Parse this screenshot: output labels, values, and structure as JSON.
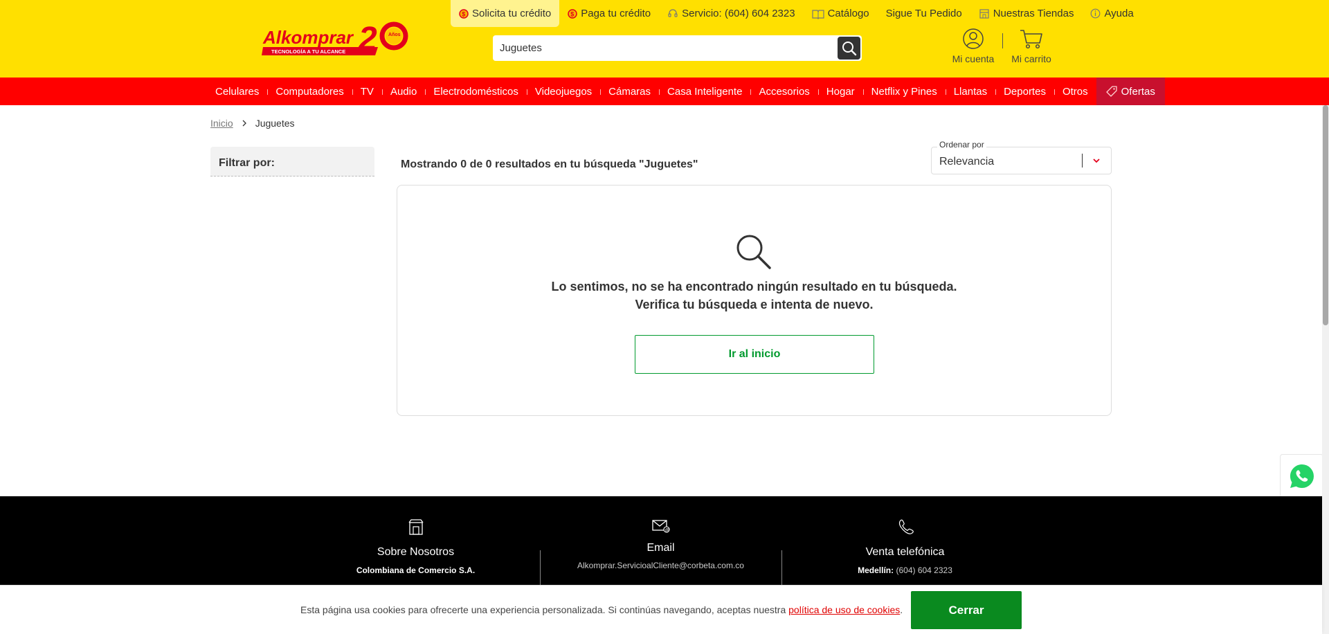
{
  "header": {
    "logo_brand": "Alkomprar",
    "logo_tagline": "TECNOLOGÍA A TU ALCANCE",
    "logo_number": "20",
    "logo_years": "Años",
    "top_links": [
      {
        "label": "Solicita tu crédito",
        "icon": "credit-coin-icon"
      },
      {
        "label": "Paga tu crédito",
        "icon": "credit-coin-icon"
      },
      {
        "label": "Servicio: (604) 604 2323",
        "icon": "headset-icon"
      },
      {
        "label": "Catálogo",
        "icon": "book-icon"
      },
      {
        "label": "Sigue Tu Pedido",
        "icon": ""
      },
      {
        "label": "Nuestras Tiendas",
        "icon": "store-icon"
      },
      {
        "label": "Ayuda",
        "icon": "info-icon"
      }
    ],
    "search": {
      "value": "Juguetes",
      "icon": "search-icon"
    },
    "account_label": "Mi cuenta",
    "cart_label": "Mi carrito"
  },
  "nav": {
    "items": [
      "Celulares",
      "Computadores",
      "TV",
      "Audio",
      "Electrodomésticos",
      "Videojuegos",
      "Cámaras",
      "Casa Inteligente",
      "Accesorios",
      "Hogar",
      "Netflix y Pines",
      "Llantas",
      "Deportes",
      "Otros"
    ],
    "offers_label": "Ofertas"
  },
  "breadcrumb": {
    "home": "Inicio",
    "current": "Juguetes"
  },
  "filter": {
    "title": "Filtrar por:"
  },
  "results": {
    "summary": "Mostrando 0 de 0 resultados en tu búsqueda \"Juguetes\"",
    "sort_label": "Ordenar por",
    "sort_value": "Relevancia",
    "empty_line1": "Lo sentimos, no se ha encontrado ningún resultado en tu búsqueda.",
    "empty_line2": "Verifica tu búsqueda e intenta de nuevo.",
    "home_button": "Ir al inicio"
  },
  "footer": {
    "about": {
      "title": "Sobre Nosotros",
      "sub": "Colombiana de Comercio S.A."
    },
    "email": {
      "title": "Email",
      "sub": "Alkomprar.ServicioalCliente@corbeta.com.co"
    },
    "phone": {
      "title": "Venta telefónica",
      "city": "Medellín:",
      "number": "(604) 604 2323"
    }
  },
  "cookie": {
    "text": "Esta página usa cookies para ofrecerte una experiencia personalizada. Si continúas navegando, aceptas nuestra",
    "link": "política de uso de cookies",
    "end": ".",
    "button": "Cerrar"
  },
  "colors": {
    "yellow": "#ffe000",
    "red": "#ff0000",
    "dark_red": "#c8102e",
    "green": "#009a2e",
    "footer": "#000000"
  }
}
